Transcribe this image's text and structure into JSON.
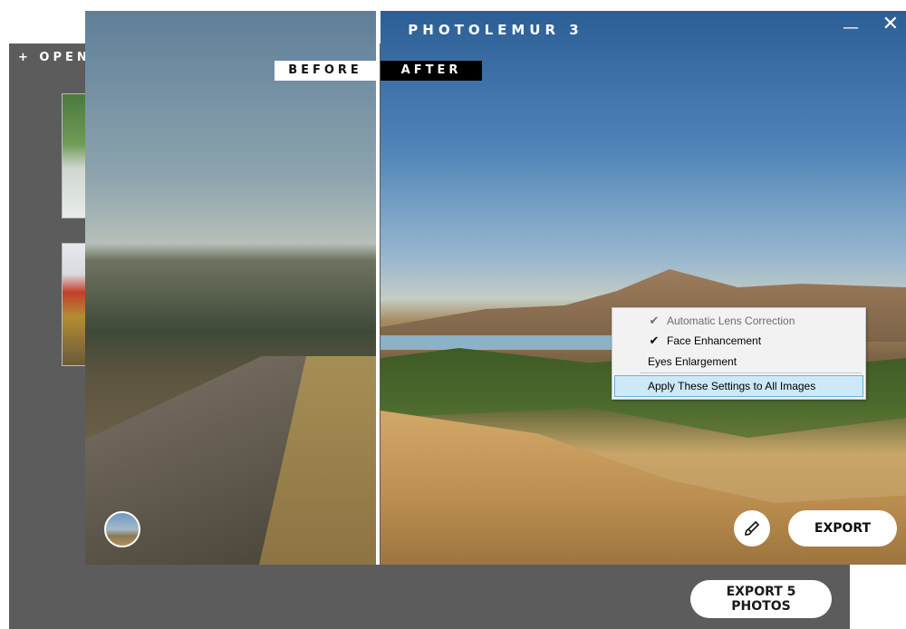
{
  "app": {
    "title": "PHOTOLEMUR 3",
    "open_label": "+ OPEN",
    "window_controls": {
      "minimize": "—",
      "close": "✕"
    }
  },
  "compare": {
    "before_label": "BEFORE",
    "after_label": "AFTER"
  },
  "actions": {
    "export_label": "EXPORT",
    "export_all_label": "EXPORT 5 PHOTOS",
    "brush_icon": "brush-icon"
  },
  "context_menu": {
    "items": [
      {
        "label": "Automatic Lens Correction",
        "checked": true,
        "disabled": true
      },
      {
        "label": "Face Enhancement",
        "checked": true,
        "disabled": false
      },
      {
        "label": "Eyes Enlargement",
        "checked": false,
        "disabled": false
      },
      {
        "label": "Apply These Settings to All Images",
        "checked": false,
        "highlighted": true
      }
    ],
    "check_glyph": "✔"
  },
  "colors": {
    "background_window": "#5c5c5c",
    "menu_highlight": "#cde8f7",
    "menu_highlight_border": "#6cb0d6"
  }
}
